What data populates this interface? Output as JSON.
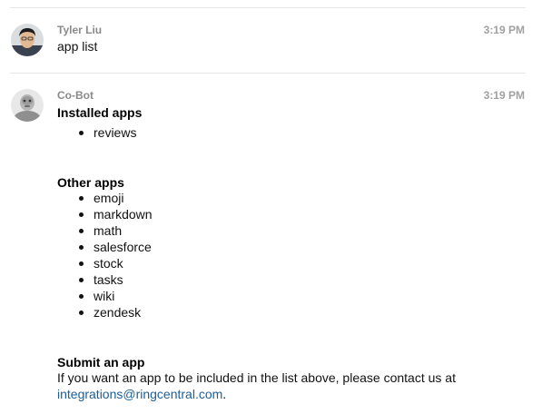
{
  "messages": [
    {
      "author": "Tyler Liu",
      "time": "3:19 PM",
      "avatar": "user-photo-avatar",
      "text": "app list"
    },
    {
      "author": "Co-Bot",
      "time": "3:19 PM",
      "avatar": "robot-avatar",
      "installed_heading": "Installed apps",
      "installed_apps": [
        "reviews"
      ],
      "other_heading": "Other apps",
      "other_apps": [
        "emoji",
        "markdown",
        "math",
        "salesforce",
        "stock",
        "tasks",
        "wiki",
        "zendesk"
      ],
      "submit_heading": "Submit an app",
      "submit_text": "If you want an app to be included in the list above, please contact us at",
      "submit_link": "integrations@ringcentral.com",
      "submit_end": "."
    }
  ],
  "colors": {
    "author": "#8a8a8a",
    "time": "#a0a0a0",
    "link": "#1a5f96",
    "divider": "#e6e6e6"
  }
}
